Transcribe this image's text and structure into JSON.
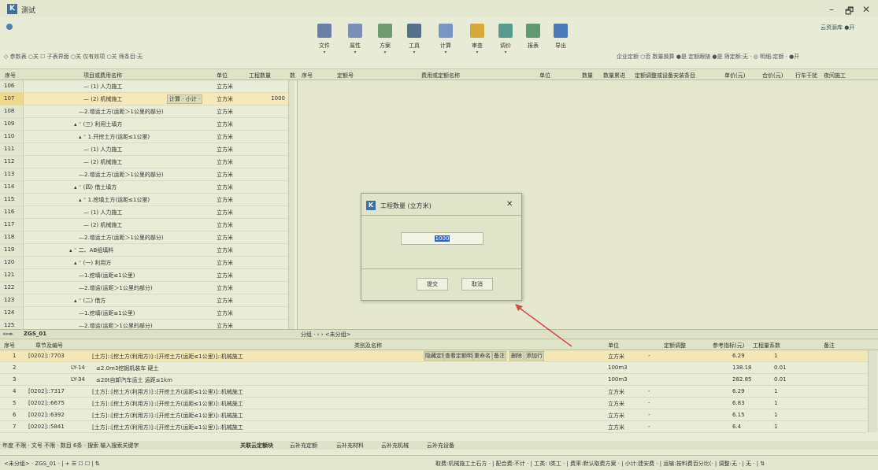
{
  "app": {
    "logo": "K",
    "title": "测试",
    "cloud_link": "云资源库 ●开"
  },
  "window_controls": {
    "minimize": "–",
    "maximize": "🗗",
    "close": "✕"
  },
  "ribbon": {
    "buttons": [
      {
        "label": "文件",
        "icon": "file-icon",
        "color": "#6b7fa8"
      },
      {
        "label": "属性",
        "icon": "properties-icon",
        "color": "#7a8fb8"
      },
      {
        "label": "方案",
        "icon": "scheme-icon",
        "color": "#6f9c6f"
      },
      {
        "label": "工具",
        "icon": "tools-icon",
        "color": "#566f8a"
      },
      {
        "label": "计算",
        "icon": "calculate-icon",
        "color": "#7896c4"
      },
      {
        "label": "审查",
        "icon": "review-icon",
        "color": "#d8a93a"
      },
      {
        "label": "调价",
        "icon": "adjust-price-icon",
        "color": "#5a9b8f"
      },
      {
        "label": "报表",
        "icon": "report-icon",
        "color": "#5f9a72"
      },
      {
        "label": "导出",
        "icon": "export-icon",
        "color": "#4b79b8"
      }
    ],
    "left_options": "◇ 参数表 ○关  ☐ 子表界面 ○关  仅有效项 ○关  筛条目:无",
    "right_options": "企业定额 ○否  数量换算 ●是  定额跟随 ●是  筛定额:无 ·  ◎ 明细:定额 · ●开"
  },
  "left_grid": {
    "headers": [
      "序号",
      "项目或费用名称",
      "单位",
      "工程数量",
      "数"
    ],
    "rows": [
      {
        "num": "106",
        "name": "— (1) 人力施工",
        "indent": 3,
        "unit": "立方米",
        "qty": ""
      },
      {
        "num": "107",
        "name": "— (2) 机械施工",
        "indent": 3,
        "unit": "立方米",
        "qty": "1000",
        "selected": true,
        "calc": "计算 · 小计 ·"
      },
      {
        "num": "108",
        "name": "—2.增运土方(运距＞1公里的部分)",
        "indent": 2,
        "unit": "立方米",
        "qty": ""
      },
      {
        "num": "109",
        "name": "▴ ⁼ (三) 利用土填方",
        "indent": 1,
        "unit": "立方米",
        "qty": ""
      },
      {
        "num": "110",
        "name": "▴ ⁼ 1.开挖土方(运距≤1公里)",
        "indent": 2,
        "unit": "立方米",
        "qty": ""
      },
      {
        "num": "111",
        "name": "— (1) 人力施工",
        "indent": 3,
        "unit": "立方米",
        "qty": ""
      },
      {
        "num": "112",
        "name": "— (2) 机械施工",
        "indent": 3,
        "unit": "立方米",
        "qty": ""
      },
      {
        "num": "113",
        "name": "—2.增运土方(运距＞1公里的部分)",
        "indent": 2,
        "unit": "立方米",
        "qty": ""
      },
      {
        "num": "114",
        "name": "▴ ⁼ (四) 借土填方",
        "indent": 1,
        "unit": "立方米",
        "qty": ""
      },
      {
        "num": "115",
        "name": "▴ ⁼ 1.挖填土方(运距≤1公里)",
        "indent": 2,
        "unit": "立方米",
        "qty": ""
      },
      {
        "num": "116",
        "name": "— (1) 人力施工",
        "indent": 3,
        "unit": "立方米",
        "qty": ""
      },
      {
        "num": "117",
        "name": "— (2) 机械施工",
        "indent": 3,
        "unit": "立方米",
        "qty": ""
      },
      {
        "num": "118",
        "name": "—2.增运土方(运距＞1公里的部分)",
        "indent": 2,
        "unit": "立方米",
        "qty": ""
      },
      {
        "num": "119",
        "name": "▴ ⁼ 二、AB组填料",
        "indent": 0,
        "unit": "立方米",
        "qty": ""
      },
      {
        "num": "120",
        "name": "▴ ⁼ (一) 利用方",
        "indent": 1,
        "unit": "立方米",
        "qty": ""
      },
      {
        "num": "121",
        "name": "—1.挖填(运距≤1公里)",
        "indent": 2,
        "unit": "立方米",
        "qty": ""
      },
      {
        "num": "122",
        "name": "—2.增运(运距＞1公里的部分)",
        "indent": 2,
        "unit": "立方米",
        "qty": ""
      },
      {
        "num": "123",
        "name": "▴ ⁼ (二) 借方",
        "indent": 1,
        "unit": "立方米",
        "qty": ""
      },
      {
        "num": "124",
        "name": "—1.挖填(运距≤1公里)",
        "indent": 2,
        "unit": "立方米",
        "qty": ""
      },
      {
        "num": "125",
        "name": "—2.增运(运距＞1公里的部分)",
        "indent": 2,
        "unit": "立方米",
        "qty": ""
      }
    ],
    "sheet_tab": "ZGS_01"
  },
  "right_grid": {
    "headers": [
      "序号",
      "定额号",
      "费用或定额名称",
      "单位",
      "数量",
      "数量累进",
      "定额调整或设备安装条目",
      "单价(元)",
      "合价(元)",
      "行车干扰",
      "夜间施工"
    ],
    "group_bar": "分组 · ‹ › <未分组>"
  },
  "dialog": {
    "title": "工程数量 (立方米)",
    "value": "1000",
    "submit": "提交",
    "cancel": "取消",
    "close": "✕"
  },
  "bottom_grid": {
    "headers": [
      "序号",
      "章节及编号",
      "类别及名称",
      "单位",
      "定额调整",
      "参考指标(元)",
      "工程量系数",
      "备注"
    ],
    "context_menu": [
      "隐藏定额",
      "查看定额明细",
      "重命名",
      "备注",
      "删除",
      "添加行"
    ],
    "rows": [
      {
        "num": "1",
        "code": "[0202]::7703",
        "name": "[土方]::[挖土方(利用方)]::[开挖土方(运距≤1公里)]::机械施工",
        "unit": "立方米",
        "adj": "-",
        "ref": "6.29",
        "factor": "1",
        "selected": true
      },
      {
        "num": "2",
        "code": "LY-14",
        "name": "≤2.0m3挖掘机装车 硬土",
        "unit": "100m3",
        "adj": "",
        "ref": "138.18",
        "factor": "0.01",
        "indent": true
      },
      {
        "num": "3",
        "code": "LY-34",
        "name": "≤20t自卸汽车运土 运距≤1km",
        "unit": "100m3",
        "adj": "",
        "ref": "282.85",
        "factor": "0.01",
        "indent": true
      },
      {
        "num": "4",
        "code": "[0202]::7317",
        "name": "[土方]::[挖土方(利用方)]::[开挖土方(运距≤1公里)]::机械施工",
        "unit": "立方米",
        "adj": "-",
        "ref": "6.29",
        "factor": "1"
      },
      {
        "num": "5",
        "code": "[0202]::6675",
        "name": "[土方]::[挖土方(利用方)]::[开挖土方(运距≤1公里)]::机械施工",
        "unit": "立方米",
        "adj": "-",
        "ref": "6.83",
        "factor": "1"
      },
      {
        "num": "6",
        "code": "[0202]::6392",
        "name": "[土方]::[挖土方(利用方)]::[开挖土方(运距≤1公里)]::机械施工",
        "unit": "立方米",
        "adj": "-",
        "ref": "6.15",
        "factor": "1"
      },
      {
        "num": "7",
        "code": "[0202]::5841",
        "name": "[土方]::[挖土方(利用方)]::[开挖土方(运距≤1公里)]::机械施工",
        "unit": "立方米",
        "adj": "-",
        "ref": "6.4",
        "factor": "1"
      }
    ],
    "filter_bar": "年度 不限 · 文号 不限  · 数目 6条 · 搜索 输入搜索关键字",
    "tabs": [
      "关联云定额块",
      "云补充定额",
      "云补充材料",
      "云补充机械",
      "云补充设备"
    ]
  },
  "statusbar": {
    "left": "<未分组> · ZGS_01 · | + ☰ ☐ ☐ | ⇅",
    "right": "取费:机械施工土石方 · | 配合费:不计 · | 工类: I类工 · | 费率:默认取费方案 · | 小计:建安费 · | 运输:按料费百分比(· | 调整:无 · | 无 · | ⇅"
  }
}
